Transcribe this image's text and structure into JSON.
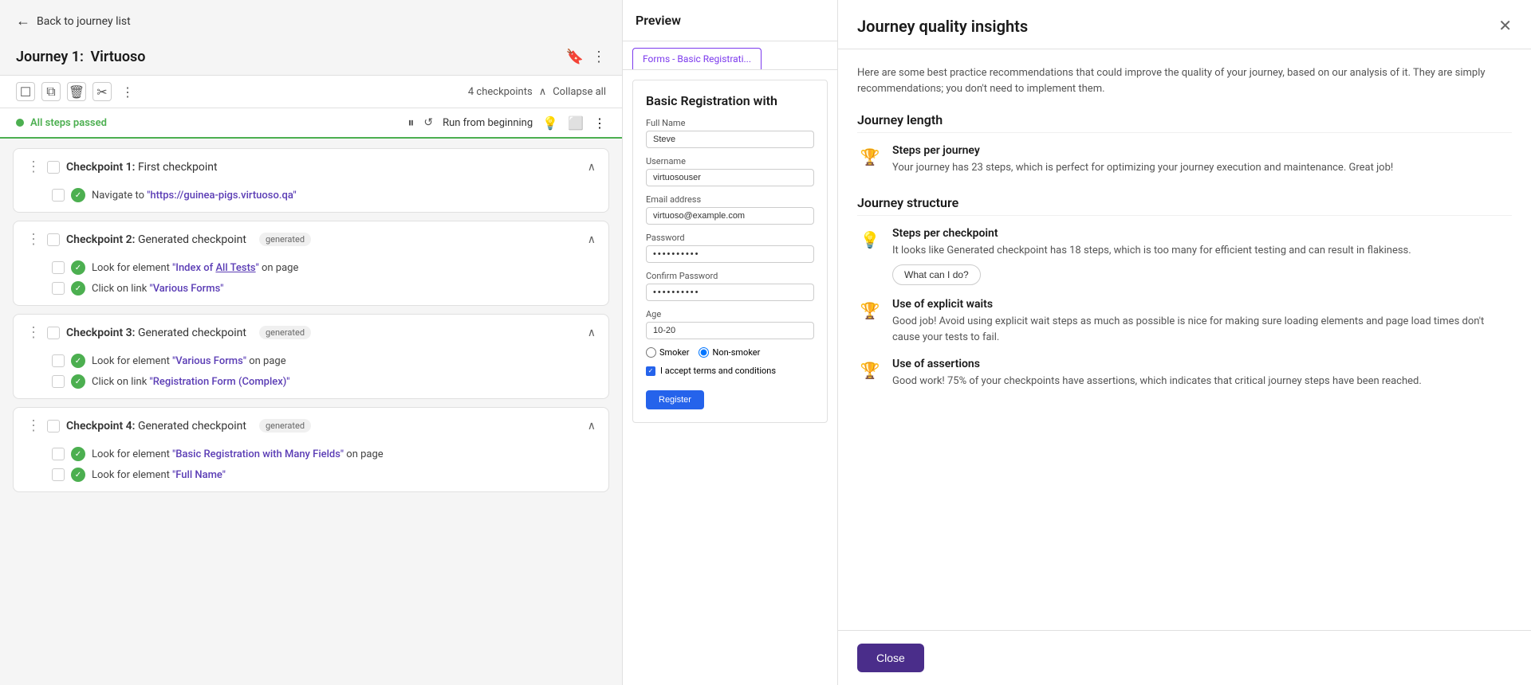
{
  "nav": {
    "back_label": "Back to journey list"
  },
  "journey": {
    "label": "Journey 1:",
    "name": "Virtuoso"
  },
  "toolbar": {
    "checkpoints_count": "4 checkpoints",
    "collapse_all": "Collapse all"
  },
  "status": {
    "text": "All steps passed",
    "run_label": "Run from beginning"
  },
  "checkpoints": [
    {
      "number": 1,
      "title": "First checkpoint",
      "badge": null,
      "steps": [
        {
          "text": "Navigate to",
          "highlight": "\"https://guinea-pigs.virtuoso.qa\"",
          "rest": ""
        }
      ]
    },
    {
      "number": 2,
      "title": "Generated checkpoint",
      "badge": "generated",
      "steps": [
        {
          "text": "Look for element",
          "highlight": "\"Index of All Tests\"",
          "rest": " on page"
        },
        {
          "text": "Click on link",
          "highlight": "\"Various Forms\"",
          "rest": ""
        }
      ]
    },
    {
      "number": 3,
      "title": "Generated checkpoint",
      "badge": "generated",
      "steps": [
        {
          "text": "Look for element",
          "highlight": "\"Various Forms\"",
          "rest": " on page"
        },
        {
          "text": "Click on link",
          "highlight": "\"Registration Form (Complex)\"",
          "rest": ""
        }
      ]
    },
    {
      "number": 4,
      "title": "Generated checkpoint",
      "badge": "generated",
      "steps": [
        {
          "text": "Look for element",
          "highlight": "\"Basic Registration with Many Fields\"",
          "rest": " on page"
        },
        {
          "text": "Look for element",
          "highlight": "\"Full Name\"",
          "rest": ""
        }
      ]
    }
  ],
  "preview": {
    "title": "Preview",
    "tab_label": "Forms - Basic Registrati...",
    "form": {
      "title": "Basic Registration with",
      "fields": [
        {
          "label": "Full Name",
          "value": "Steve",
          "type": "text"
        },
        {
          "label": "Username",
          "value": "virtuosouser",
          "type": "text"
        },
        {
          "label": "Email address",
          "value": "virtuoso@example.com",
          "type": "text"
        },
        {
          "label": "Password",
          "value": "••••••••••",
          "type": "password"
        },
        {
          "label": "Confirm Password",
          "value": "••••••••••",
          "type": "password"
        },
        {
          "label": "Age",
          "value": "10-20",
          "type": "text"
        }
      ],
      "smoker_label": "Smoker",
      "nonsmoker_label": "Non-smoker",
      "nonsmoker_selected": true,
      "terms_label": "I accept terms and conditions",
      "register_btn": "Register"
    }
  },
  "insights": {
    "title": "Journey quality insights",
    "description": "Here are some best practice recommendations that could improve the quality of your journey, based on our analysis of it. They are simply recommendations; you don't need to implement them.",
    "close_btn": "Close",
    "sections": [
      {
        "title": "Journey length",
        "items": [
          {
            "icon": "trophy",
            "icon_type": "trophy",
            "title": "Steps per journey",
            "description": "Your journey has 23 steps, which is perfect for optimizing your journey execution and maintenance. Great job!",
            "action": null
          }
        ]
      },
      {
        "title": "Journey structure",
        "items": [
          {
            "icon": "bulb",
            "icon_type": "bulb",
            "title": "Steps per checkpoint",
            "description": "It looks like Generated checkpoint has 18 steps, which is too many for efficient testing and can result in flakiness.",
            "action": "What can I do?"
          },
          {
            "icon": "trophy",
            "icon_type": "trophy",
            "title": "Use of explicit waits",
            "description": "Good job! Avoid using explicit wait steps as much as possible is nice for making sure loading elements and page load times don't cause your tests to fail.",
            "action": null
          },
          {
            "icon": "trophy",
            "icon_type": "trophy",
            "title": "Use of assertions",
            "description": "Good work! 75% of your checkpoints have assertions, which indicates that critical journey steps have been reached.",
            "action": null
          }
        ]
      }
    ]
  }
}
